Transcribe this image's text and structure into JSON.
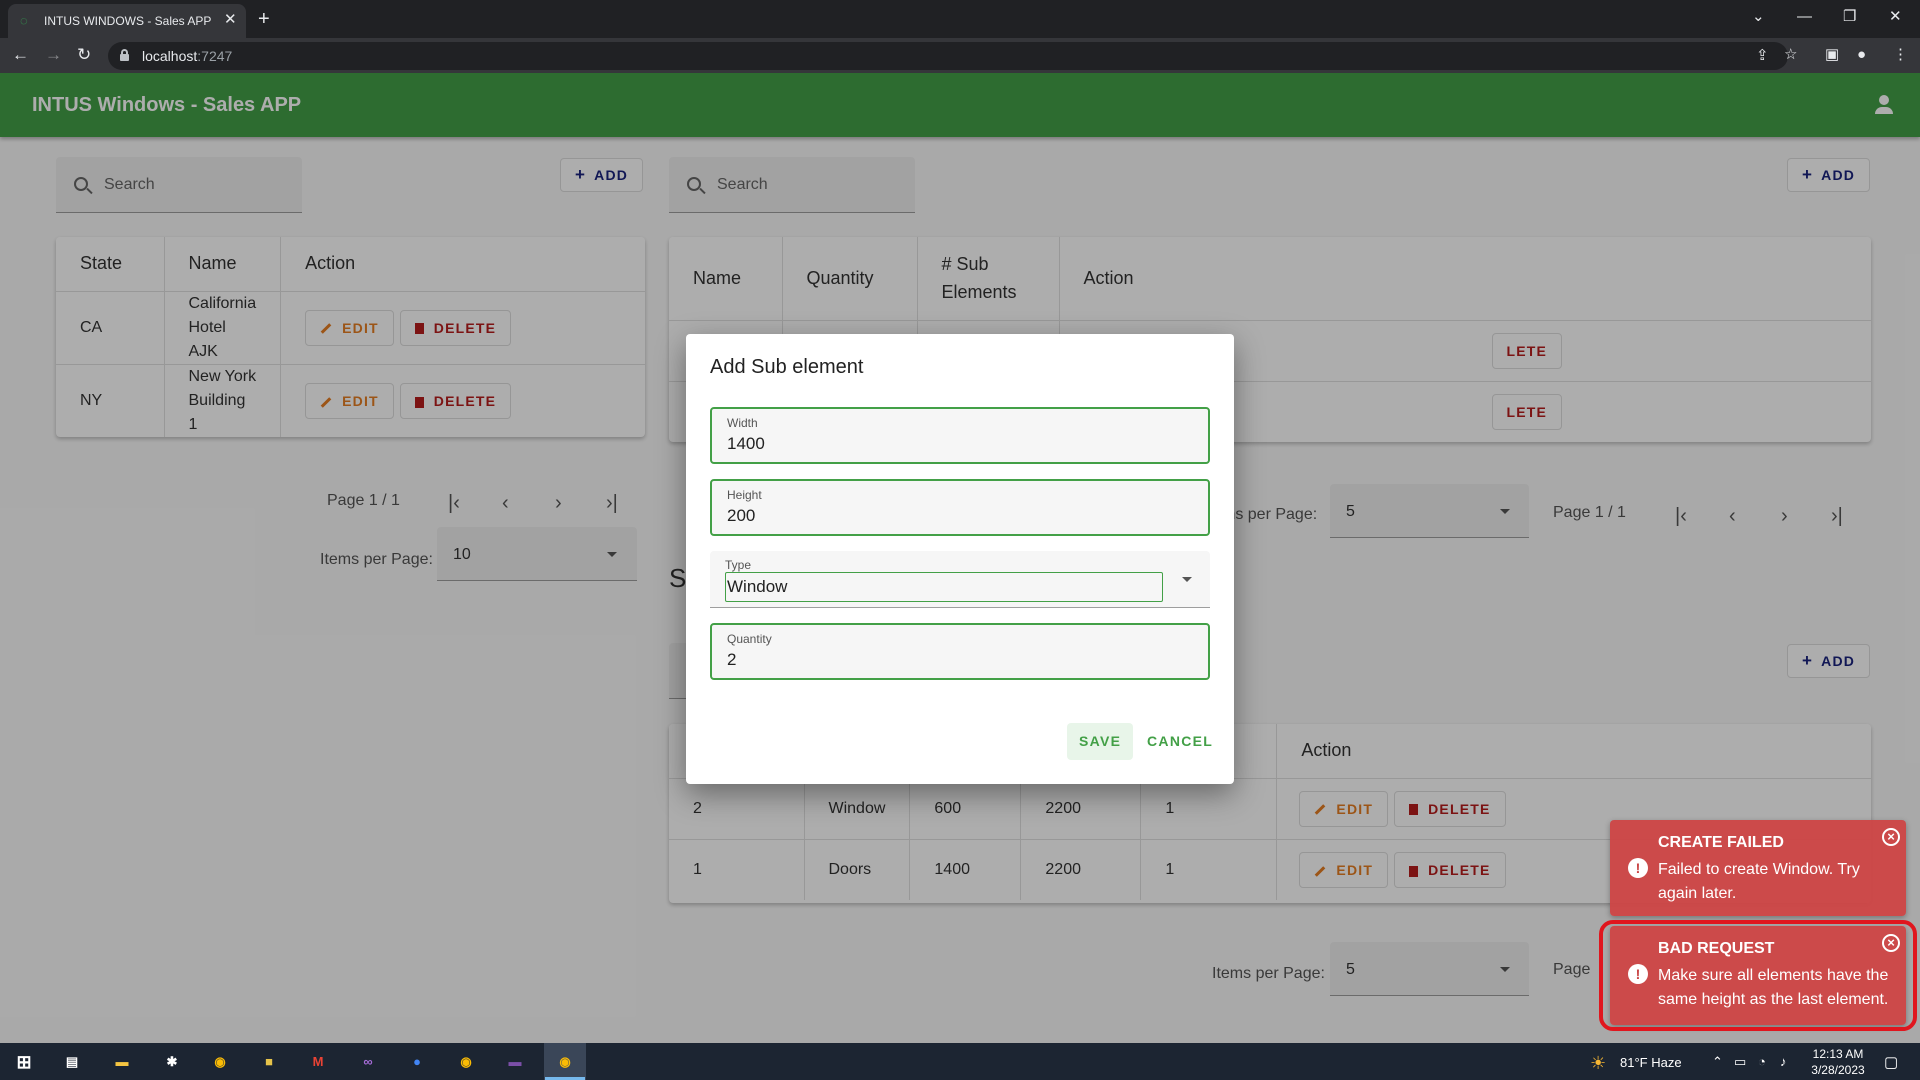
{
  "browser": {
    "tab_title": "INTUS WINDOWS - Sales APP",
    "url_host": "localhost",
    "url_port": ":7247"
  },
  "app": {
    "title": "INTUS Windows - Sales APP"
  },
  "left_panel": {
    "search_label": "Search",
    "add_label": "ADD",
    "columns": [
      "State",
      "Name",
      "Action"
    ],
    "rows": [
      {
        "state": "CA",
        "name_line1": "California",
        "name_line2": "Hotel AJK"
      },
      {
        "state": "NY",
        "name_line1": "New York",
        "name_line2": "Building 1"
      }
    ],
    "edit_label": "EDIT",
    "delete_label": "DELETE",
    "page_info": "Page 1 / 1",
    "items_per_page_label": "Items per Page:",
    "items_per_page_value": "10"
  },
  "right_top_panel": {
    "search_label": "Search",
    "add_label": "ADD",
    "columns": [
      "Name",
      "Quantity",
      "# Sub Elements",
      "Action"
    ],
    "col_sub_line1": "# Sub",
    "col_sub_line2": "Elements",
    "hidden_delete_fragment": "LETE",
    "items_per_page_label": "ms per Page:",
    "items_per_page_value": "5",
    "page_info": "Page 1 / 1"
  },
  "right_bottom_panel": {
    "heading_fragment": "S",
    "add_label": "ADD",
    "action_column": "Action",
    "rows": [
      {
        "id": "2",
        "type": "Window",
        "width": "600",
        "height": "2200",
        "quantity": "1"
      },
      {
        "id": "1",
        "type": "Doors",
        "width": "1400",
        "height": "2200",
        "quantity": "1"
      }
    ],
    "edit_label": "EDIT",
    "delete_label": "DELETE",
    "items_per_page_label": "Items per Page:",
    "items_per_page_value": "5",
    "page_fragment": "Page"
  },
  "dialog": {
    "title": "Add Sub element",
    "width_label": "Width",
    "width_value": "1400",
    "height_label": "Height",
    "height_value": "200",
    "type_label": "Type",
    "type_value": "Window",
    "quantity_label": "Quantity",
    "quantity_value": "2",
    "save_label": "SAVE",
    "cancel_label": "CANCEL"
  },
  "toasts": [
    {
      "title": "CREATE FAILED",
      "message": "Failed to create Window. Try again later."
    },
    {
      "title": "BAD REQUEST",
      "message": "Make sure all elements have the same height as the last element."
    }
  ],
  "taskbar": {
    "weather": "81°F  Haze",
    "time": "12:13 AM",
    "date": "3/28/2023"
  },
  "colors": {
    "appbar": "#43a047",
    "toast": "#cd4646",
    "highlight": "#e0161e"
  }
}
